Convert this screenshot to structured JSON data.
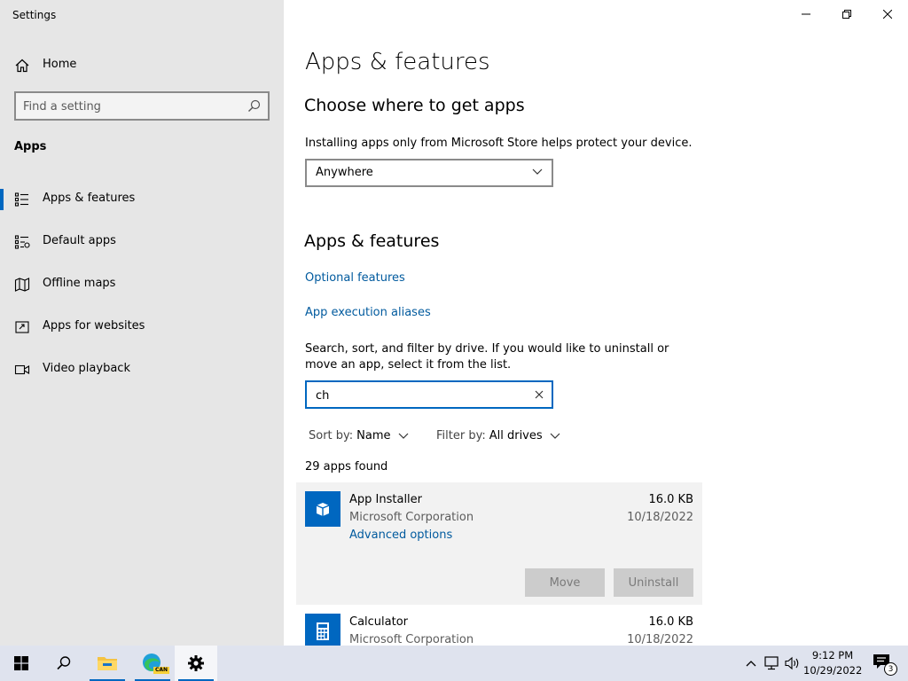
{
  "window": {
    "title": "Settings"
  },
  "sidebar": {
    "home_label": "Home",
    "search_placeholder": "Find a setting",
    "section_label": "Apps",
    "items": [
      {
        "label": "Apps & features",
        "icon": "list-icon",
        "active": true
      },
      {
        "label": "Default apps",
        "icon": "default-apps-icon"
      },
      {
        "label": "Offline maps",
        "icon": "map-icon"
      },
      {
        "label": "Apps for websites",
        "icon": "open-external-icon"
      },
      {
        "label": "Video playback",
        "icon": "video-icon"
      }
    ]
  },
  "main": {
    "title": "Apps & features",
    "choose_heading": "Choose where to get apps",
    "choose_desc": "Installing apps only from Microsoft Store helps protect your device.",
    "source_dropdown_value": "Anywhere",
    "features_heading": "Apps & features",
    "optional_features_link": "Optional features",
    "aliases_link": "App execution aliases",
    "filter_desc": "Search, sort, and filter by drive. If you would like to uninstall or move an app, select it from the list.",
    "filter_value": "ch",
    "sort_key": "Sort by:",
    "sort_value": "Name",
    "filter_key": "Filter by:",
    "filter_drive": "All drives",
    "apps_found": "29 apps found",
    "apps": [
      {
        "name": "App Installer",
        "publisher": "Microsoft Corporation",
        "size": "16.0 KB",
        "date": "10/18/2022",
        "advanced": "Advanced options",
        "move": "Move",
        "uninstall": "Uninstall",
        "selected": true
      },
      {
        "name": "Calculator",
        "publisher": "Microsoft Corporation",
        "size": "16.0 KB",
        "date": "10/18/2022"
      }
    ]
  },
  "taskbar": {
    "time": "9:12 PM",
    "date": "10/29/2022",
    "notification_count": "3",
    "edge_badge": "CAN"
  },
  "colors": {
    "accent": "#0067c0",
    "link": "#005a9e",
    "sidebar_bg": "#e6e6e6",
    "taskbar_bg": "#dfe3ee"
  }
}
